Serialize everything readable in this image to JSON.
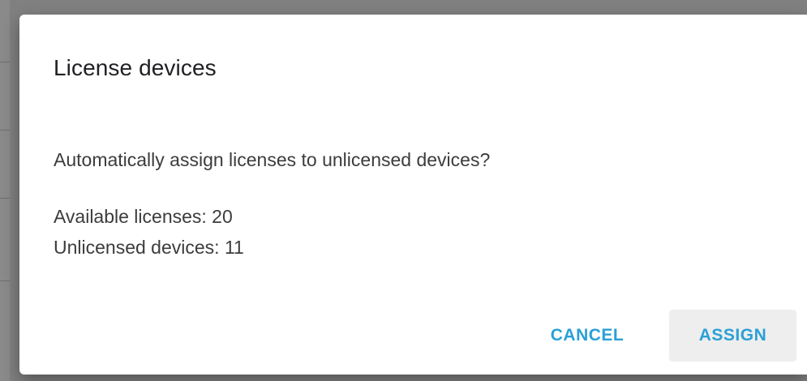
{
  "dialog": {
    "title": "License devices",
    "question": "Automatically assign licenses to unlicensed devices?",
    "available_licenses": "Available licenses: 20",
    "unlicensed_devices": "Unlicensed devices: 11",
    "cancel_label": "CANCEL",
    "assign_label": "ASSIGN"
  },
  "colors": {
    "accent": "#2aa0d6",
    "overlay": "#808080",
    "assign_button_bg": "#eeeeee"
  }
}
